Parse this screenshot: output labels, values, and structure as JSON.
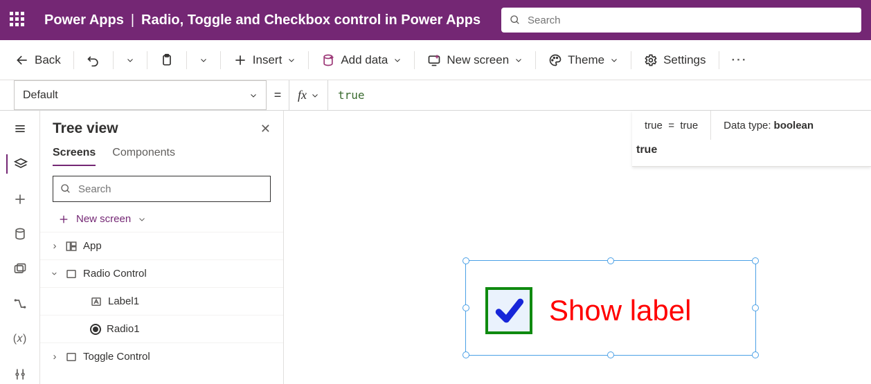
{
  "header": {
    "brand": "Power Apps",
    "separator": "|",
    "app_title": "Radio, Toggle and Checkbox control in Power Apps",
    "search_placeholder": "Search"
  },
  "cmdbar": {
    "back": "Back",
    "insert": "Insert",
    "add_data": "Add data",
    "new_screen": "New screen",
    "theme": "Theme",
    "settings": "Settings"
  },
  "formula": {
    "property": "Default",
    "eq": "=",
    "fx": "fx",
    "expression": "true",
    "intelli_expr_l": "true",
    "intelli_expr_op": "=",
    "intelli_expr_r": "true",
    "data_type_label": "Data type:",
    "data_type_value": "boolean",
    "result_preview": "true"
  },
  "rail": {
    "hamburger": "hamburger",
    "tree": "tree",
    "insert": "insert",
    "data": "data",
    "media": "media",
    "flows": "flows",
    "vars": "(𝑥)",
    "tools": "tools"
  },
  "panel": {
    "title": "Tree view",
    "tabs": {
      "screens": "Screens",
      "components": "Components"
    },
    "search_placeholder": "Search",
    "new_screen": "New screen",
    "tree": {
      "app": "App",
      "radio_screen": "Radio Control",
      "label1": "Label1",
      "radio1": "Radio1",
      "toggle_screen": "Toggle Control"
    }
  },
  "canvas": {
    "checkbox_label": "Show label"
  }
}
